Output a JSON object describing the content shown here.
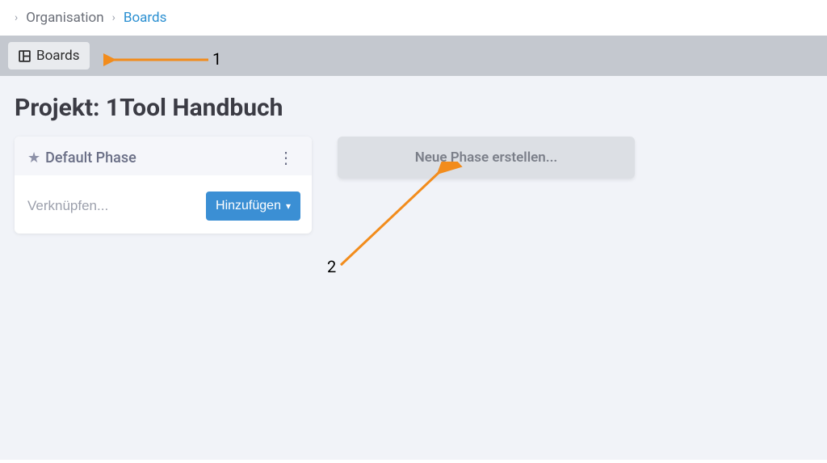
{
  "breadcrumb": {
    "level1": "Organisation",
    "level2": "Boards"
  },
  "tabs": {
    "boards": "Boards"
  },
  "page": {
    "title": "Projekt: 1Tool Handbuch"
  },
  "phase_card": {
    "name": "Default Phase",
    "link_placeholder": "Verknüpfen...",
    "add_button": "Hinzufügen"
  },
  "new_phase": {
    "label": "Neue Phase erstellen..."
  },
  "annotations": {
    "one": "1",
    "two": "2"
  },
  "colors": {
    "accent_blue": "#3b8fd4",
    "link_blue": "#2a8fd1",
    "annotation_orange": "#f28c1c"
  }
}
